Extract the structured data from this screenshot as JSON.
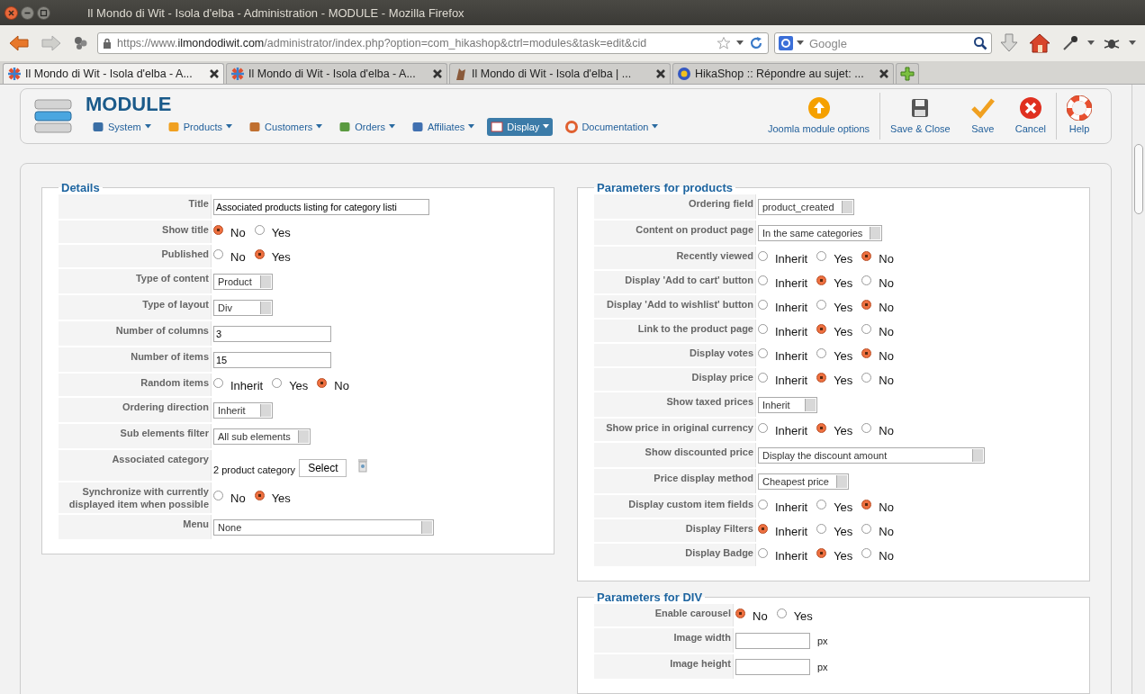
{
  "window": {
    "title": "Il Mondo di Wit - Isola d'elba - Administration - MODULE - Mozilla Firefox"
  },
  "address_bar": {
    "scheme": "https://www.",
    "domain": "ilmondodiwit.com",
    "path": "/administrator/index.php?option=com_hikashop&ctrl=modules&task=edit&cid"
  },
  "search": {
    "placeholder": "Google"
  },
  "tabs": [
    {
      "label": "Il Mondo di Wit - Isola d'elba - A...",
      "selected": true
    },
    {
      "label": "Il Mondo di Wit - Isola d'elba - A...",
      "selected": false
    },
    {
      "label": "Il Mondo di Wit - Isola d'elba | ...",
      "selected": false
    },
    {
      "label": "HikaShop :: Répondre au sujet: ...",
      "selected": false
    }
  ],
  "header": {
    "title": "MODULE",
    "menu": [
      {
        "label": "System",
        "selected": false
      },
      {
        "label": "Products",
        "selected": false
      },
      {
        "label": "Customers",
        "selected": false
      },
      {
        "label": "Orders",
        "selected": false
      },
      {
        "label": "Affiliates",
        "selected": false
      },
      {
        "label": "Display",
        "selected": true
      },
      {
        "label": "Documentation",
        "selected": false
      }
    ],
    "actions": [
      "Joomla module options",
      "Save & Close",
      "Save",
      "Cancel",
      "Help"
    ]
  },
  "sections": [
    {
      "title": "Details",
      "fields": [
        {
          "kind": "text",
          "label": "Title",
          "value": "Associated products listing for category listi"
        },
        {
          "kind": "radio",
          "label": "Show title",
          "options": [
            {
              "label": "No",
              "selected": true
            },
            {
              "label": "Yes",
              "selected": false
            }
          ]
        },
        {
          "kind": "radio",
          "label": "Published",
          "options": [
            {
              "label": "No",
              "selected": false
            },
            {
              "label": "Yes",
              "selected": true
            }
          ]
        },
        {
          "kind": "select",
          "label": "Type of content",
          "value": "Product"
        },
        {
          "kind": "select",
          "label": "Type of layout",
          "value": "Div"
        },
        {
          "kind": "text",
          "label": "Number of columns",
          "value": "3"
        },
        {
          "kind": "text",
          "label": "Number of items",
          "value": "15"
        },
        {
          "kind": "radio",
          "label": "Random items",
          "options": [
            {
              "label": "Inherit",
              "selected": false
            },
            {
              "label": "Yes",
              "selected": false
            },
            {
              "label": "No",
              "selected": true
            }
          ]
        },
        {
          "kind": "select",
          "label": "Ordering direction",
          "value": "Inherit"
        },
        {
          "kind": "select",
          "label": "Sub elements filter",
          "value": "All sub elements"
        },
        {
          "kind": "category",
          "label": "Associated category",
          "value": "2 product category",
          "button": "Select"
        },
        {
          "kind": "radio",
          "label": "Synchronize with currently displayed item when possible",
          "options": [
            {
              "label": "No",
              "selected": false
            },
            {
              "label": "Yes",
              "selected": true
            }
          ]
        },
        {
          "kind": "select",
          "label": "Menu",
          "value": "None"
        }
      ]
    },
    {
      "title": "Parameters for products",
      "fields": [
        {
          "kind": "select",
          "label": "Ordering field",
          "value": "product_created"
        },
        {
          "kind": "select",
          "label": "Content on product page",
          "value": "In the same categories"
        },
        {
          "kind": "radio",
          "label": "Recently viewed",
          "options": [
            {
              "label": "Inherit",
              "selected": false
            },
            {
              "label": "Yes",
              "selected": false
            },
            {
              "label": "No",
              "selected": true
            }
          ]
        },
        {
          "kind": "radio",
          "label": "Display 'Add to cart' button",
          "options": [
            {
              "label": "Inherit",
              "selected": false
            },
            {
              "label": "Yes",
              "selected": true
            },
            {
              "label": "No",
              "selected": false
            }
          ]
        },
        {
          "kind": "radio",
          "label": "Display 'Add to wishlist' button",
          "options": [
            {
              "label": "Inherit",
              "selected": false
            },
            {
              "label": "Yes",
              "selected": false
            },
            {
              "label": "No",
              "selected": true
            }
          ]
        },
        {
          "kind": "radio",
          "label": "Link to the product page",
          "options": [
            {
              "label": "Inherit",
              "selected": false
            },
            {
              "label": "Yes",
              "selected": true
            },
            {
              "label": "No",
              "selected": false
            }
          ]
        },
        {
          "kind": "radio",
          "label": "Display votes",
          "options": [
            {
              "label": "Inherit",
              "selected": false
            },
            {
              "label": "Yes",
              "selected": false
            },
            {
              "label": "No",
              "selected": true
            }
          ]
        },
        {
          "kind": "radio",
          "label": "Display price",
          "options": [
            {
              "label": "Inherit",
              "selected": false
            },
            {
              "label": "Yes",
              "selected": true
            },
            {
              "label": "No",
              "selected": false
            }
          ]
        },
        {
          "kind": "select",
          "label": "Show taxed prices",
          "value": "Inherit"
        },
        {
          "kind": "radio",
          "label": "Show price in original currency",
          "options": [
            {
              "label": "Inherit",
              "selected": false
            },
            {
              "label": "Yes",
              "selected": true
            },
            {
              "label": "No",
              "selected": false
            }
          ]
        },
        {
          "kind": "select",
          "label": "Show discounted price",
          "value": "Display the discount amount"
        },
        {
          "kind": "select",
          "label": "Price display method",
          "value": "Cheapest price"
        },
        {
          "kind": "radio",
          "label": "Display custom item fields",
          "options": [
            {
              "label": "Inherit",
              "selected": false
            },
            {
              "label": "Yes",
              "selected": false
            },
            {
              "label": "No",
              "selected": true
            }
          ]
        },
        {
          "kind": "radio",
          "label": "Display Filters",
          "options": [
            {
              "label": "Inherit",
              "selected": true
            },
            {
              "label": "Yes",
              "selected": false
            },
            {
              "label": "No",
              "selected": false
            }
          ]
        },
        {
          "kind": "radio",
          "label": "Display Badge",
          "options": [
            {
              "label": "Inherit",
              "selected": false
            },
            {
              "label": "Yes",
              "selected": true
            },
            {
              "label": "No",
              "selected": false
            }
          ]
        }
      ]
    },
    {
      "title": "Parameters for DIV",
      "fields": [
        {
          "kind": "radio",
          "label": "Enable carousel",
          "options": [
            {
              "label": "No",
              "selected": true
            },
            {
              "label": "Yes",
              "selected": false
            }
          ]
        },
        {
          "kind": "unit",
          "label": "Image width",
          "unit": "px"
        },
        {
          "kind": "unit",
          "label": "Image height",
          "unit": "px"
        }
      ]
    }
  ]
}
